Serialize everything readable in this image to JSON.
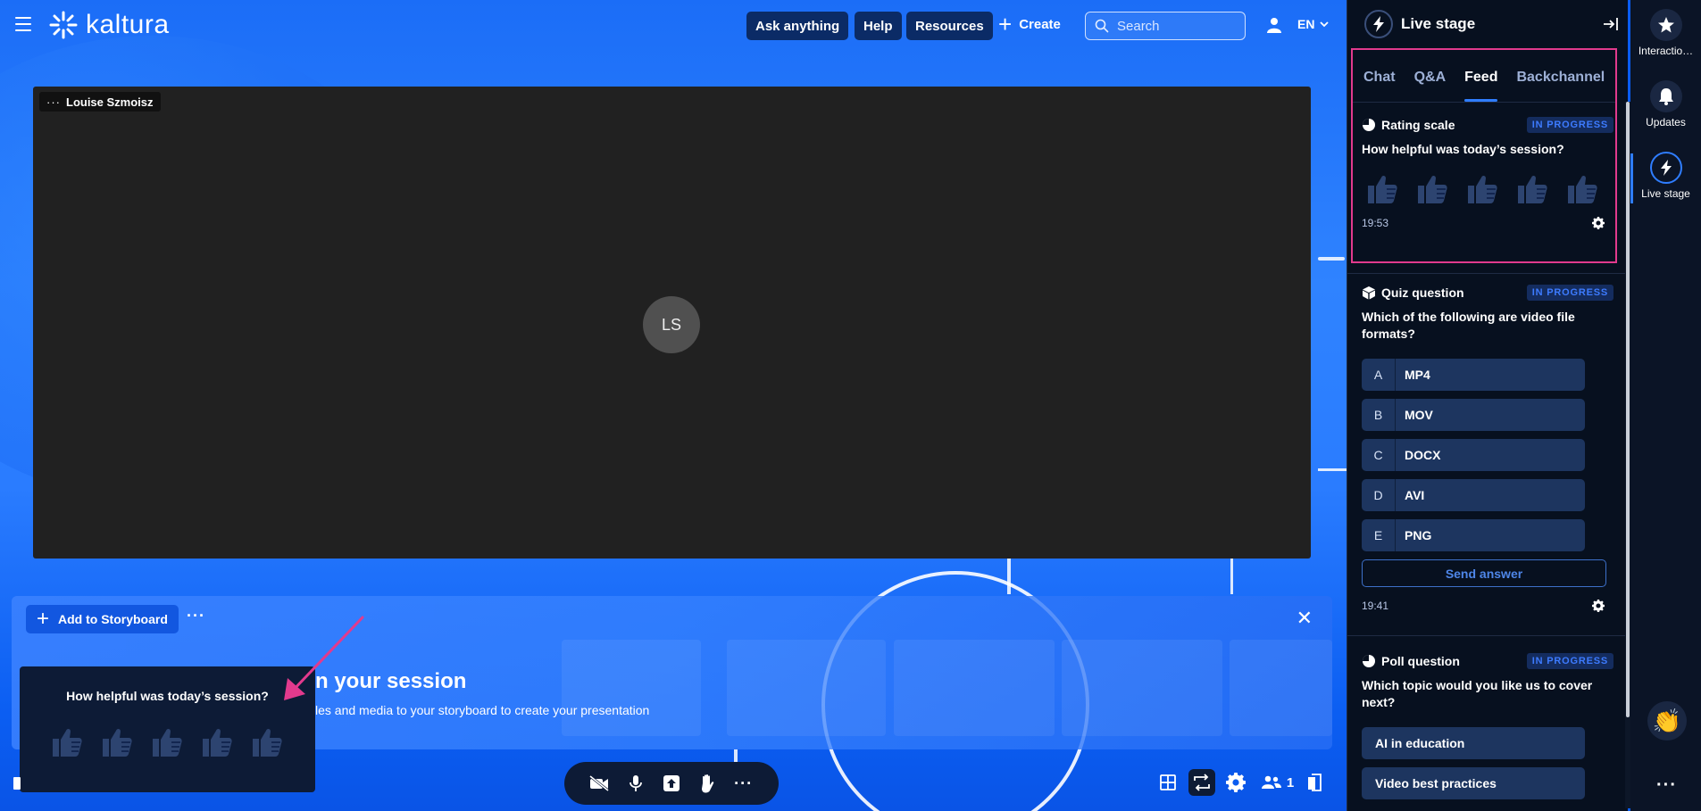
{
  "topbar": {
    "logo_text": "kaltura",
    "ask_anything": "Ask anything",
    "help": "Help",
    "resources": "Resources",
    "create": "Create",
    "search_placeholder": "Search",
    "language": "EN"
  },
  "video": {
    "participant_name": "Louise Szmoisz",
    "avatar_initials": "LS"
  },
  "storyboard": {
    "add_label": "Add to Storyboard",
    "title": "n your session",
    "subtitle": "les and media to your storyboard to create your presentation"
  },
  "popup": {
    "question": "How helpful was today’s session?"
  },
  "panel": {
    "title": "Live stage",
    "tabs": [
      {
        "label": "Chat"
      },
      {
        "label": "Q&A"
      },
      {
        "label": "Feed"
      },
      {
        "label": "Backchannel"
      }
    ],
    "active_tab": "Feed",
    "rating_card": {
      "type": "Rating scale",
      "status": "IN PROGRESS",
      "question": "How helpful was today’s session?",
      "time": "19:53"
    },
    "quiz_card": {
      "type": "Quiz question",
      "status": "IN PROGRESS",
      "question": "Which of the following are video file formats?",
      "options": [
        {
          "letter": "A",
          "text": "MP4"
        },
        {
          "letter": "B",
          "text": "MOV"
        },
        {
          "letter": "C",
          "text": "DOCX"
        },
        {
          "letter": "D",
          "text": "AVI"
        },
        {
          "letter": "E",
          "text": "PNG"
        }
      ],
      "send_label": "Send answer",
      "time": "19:41"
    },
    "poll_card": {
      "type": "Poll question",
      "status": "IN PROGRESS",
      "question": "Which topic would you like us to cover next?",
      "options": [
        {
          "text": "AI in education"
        },
        {
          "text": "Video best practices"
        }
      ]
    }
  },
  "rail": {
    "items": [
      {
        "label": "Interactio…"
      },
      {
        "label": "Updates"
      },
      {
        "label": "Live stage"
      }
    ]
  },
  "toolbar": {
    "participants_count": "1"
  },
  "colors": {
    "accent": "#2f7dff",
    "badge_text": "#3d7bff",
    "highlight_box": "#e23a8d",
    "panel_bg": "#07101f",
    "option_bg": "#1d355f",
    "popup_bg": "#0d1b36"
  }
}
